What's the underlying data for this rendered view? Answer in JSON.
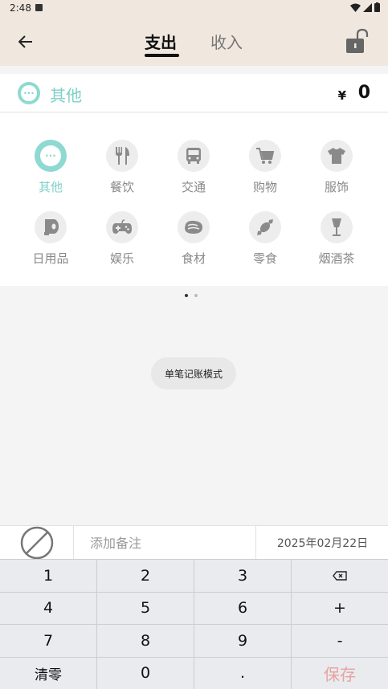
{
  "status_bar": {
    "time": "2:48"
  },
  "header": {
    "tabs": {
      "expense": "支出",
      "income": "收入"
    },
    "icons": {
      "back": "arrow-left-icon",
      "lock": "unlocked-padlock-icon"
    }
  },
  "selected": {
    "label": "其他",
    "currency": "¥",
    "amount": "0",
    "icon": "more-dots-icon"
  },
  "categories": [
    {
      "label": "其他",
      "icon": "more-dots-icon"
    },
    {
      "label": "餐饮",
      "icon": "fork-knife-icon"
    },
    {
      "label": "交通",
      "icon": "bus-icon"
    },
    {
      "label": "购物",
      "icon": "cart-icon"
    },
    {
      "label": "服饰",
      "icon": "shirt-icon"
    },
    {
      "label": "日用品",
      "icon": "tissue-roll-icon"
    },
    {
      "label": "娱乐",
      "icon": "gamepad-icon"
    },
    {
      "label": "食材",
      "icon": "meat-icon"
    },
    {
      "label": "零食",
      "icon": "candy-icon"
    },
    {
      "label": "烟酒茶",
      "icon": "wine-glass-icon"
    }
  ],
  "mode_chip": "单笔记账模式",
  "note": {
    "placeholder": "添加备注",
    "date": "2025年02月22日"
  },
  "keypad": [
    "1",
    "2",
    "3",
    "⌫",
    "4",
    "5",
    "6",
    "+",
    "7",
    "8",
    "9",
    "-",
    "清零",
    "0",
    ".",
    "保存"
  ],
  "colors": {
    "accent": "#8ed9d2",
    "header_bg": "#f0e8df",
    "save": "#e8a2a0"
  }
}
